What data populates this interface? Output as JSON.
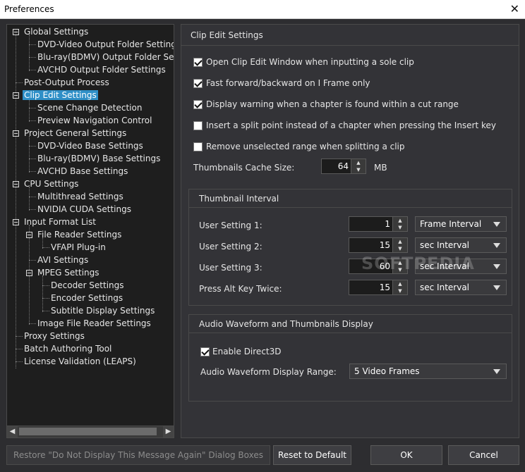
{
  "window": {
    "title": "Preferences",
    "close_glyph": "✕"
  },
  "tree": {
    "items": [
      {
        "label": "Global Settings"
      },
      {
        "label": "DVD-Video Output Folder Settings"
      },
      {
        "label": "Blu-ray(BDMV) Output Folder Settings"
      },
      {
        "label": "AVCHD Output Folder Settings"
      },
      {
        "label": "Post-Output Process"
      },
      {
        "label": "Clip Edit Settings"
      },
      {
        "label": "Scene Change Detection"
      },
      {
        "label": "Preview Navigation Control"
      },
      {
        "label": "Project General Settings"
      },
      {
        "label": "DVD-Video Base Settings"
      },
      {
        "label": "Blu-ray(BDMV) Base Settings"
      },
      {
        "label": "AVCHD Base Settings"
      },
      {
        "label": "CPU Settings"
      },
      {
        "label": "Multithread Settings"
      },
      {
        "label": "NVIDIA CUDA Settings"
      },
      {
        "label": "Input Format List"
      },
      {
        "label": "File Reader Settings"
      },
      {
        "label": "VFAPI Plug-in"
      },
      {
        "label": "AVI Settings"
      },
      {
        "label": "MPEG Settings"
      },
      {
        "label": "Decoder Settings"
      },
      {
        "label": "Encoder Settings"
      },
      {
        "label": "Subtitle Display Settings"
      },
      {
        "label": "Image File Reader Settings"
      },
      {
        "label": "Proxy Settings"
      },
      {
        "label": "Batch Authoring Tool"
      },
      {
        "label": "License Validation (LEAPS)"
      }
    ],
    "selected": "Clip Edit Settings",
    "scroll_left": "◀",
    "scroll_right": "▶"
  },
  "panel": {
    "title": "Clip Edit Settings",
    "options": [
      {
        "label": "Open Clip Edit Window when inputting a sole clip",
        "checked": true
      },
      {
        "label": "Fast forward/backward on I Frame only",
        "checked": true
      },
      {
        "label": "Display warning when a chapter is found within a cut range",
        "checked": true
      },
      {
        "label": "Insert a split point instead of a chapter when pressing the Insert key",
        "checked": false
      },
      {
        "label": "Remove unselected range when splitting a clip",
        "checked": false
      }
    ],
    "cache": {
      "label": "Thumbnails Cache Size:",
      "value": "64",
      "unit": "MB"
    },
    "thumbnail_interval": {
      "title": "Thumbnail Interval",
      "rows": [
        {
          "label": "User Setting 1:",
          "value": "1",
          "unit": "Frame Interval"
        },
        {
          "label": "User Setting 2:",
          "value": "15",
          "unit": "sec Interval"
        },
        {
          "label": "User Setting 3:",
          "value": "60",
          "unit": "sec Interval"
        },
        {
          "label": "Press Alt Key Twice:",
          "value": "15",
          "unit": "sec Interval"
        }
      ]
    },
    "audio": {
      "title": "Audio Waveform and Thumbnails Display",
      "direct3d_label": "Enable Direct3D",
      "direct3d_checked": true,
      "range_label": "Audio Waveform Display Range:",
      "range_value": "5 Video Frames"
    }
  },
  "buttons": {
    "restore": "Restore \"Do Not Display This Message Again\" Dialog Boxes",
    "reset": "Reset to Default",
    "ok": "OK",
    "cancel": "Cancel"
  },
  "watermark": "SOFTPEDIA",
  "spin_up": "▲",
  "spin_down": "▼"
}
